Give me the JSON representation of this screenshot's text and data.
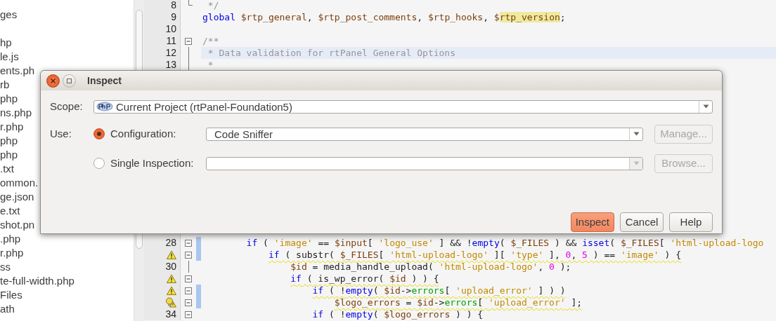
{
  "project_tree": {
    "items": [
      {
        "label": "ges"
      },
      {
        "label": "hp"
      },
      {
        "label": "le.js"
      },
      {
        "label": "ents.ph"
      },
      {
        "label": "rb"
      },
      {
        "label": "php"
      },
      {
        "label": "ns.php"
      },
      {
        "label": "r.php"
      },
      {
        "label": "php"
      },
      {
        "label": "php"
      },
      {
        "label": ".txt"
      },
      {
        "label": "ommon."
      },
      {
        "label": "ge.json"
      },
      {
        "label": "e.txt"
      },
      {
        "label": "shot.pn"
      },
      {
        "label": ".php"
      },
      {
        "label": "r.php"
      },
      {
        "label": "ss"
      },
      {
        "label": "te-full-width.php"
      },
      {
        "label": "Files"
      },
      {
        "label": "ath"
      }
    ]
  },
  "editor": {
    "top_lines": [
      {
        "number": "8",
        "fold_end": true,
        "tokens": [
          {
            "kind": "comment",
            "text": " */"
          }
        ]
      },
      {
        "number": "9",
        "tokens": [
          {
            "kind": "keyword",
            "text": "global"
          },
          {
            "kind": "variable",
            "text": " $rtp_general"
          },
          {
            "kind": "plain",
            "text": ", "
          },
          {
            "kind": "variable",
            "text": "$rtp_post_comments"
          },
          {
            "kind": "plain",
            "text": ", "
          },
          {
            "kind": "variable",
            "text": "$rtp_hooks"
          },
          {
            "kind": "plain",
            "text": ", "
          },
          {
            "kind": "variable",
            "text": "$"
          },
          {
            "kind": "variable",
            "text": "rtp_version",
            "marked": true
          },
          {
            "kind": "plain",
            "text": ";"
          }
        ]
      },
      {
        "number": "10"
      },
      {
        "number": "11",
        "fold_start": true,
        "tokens": [
          {
            "kind": "comment",
            "text": "/**"
          }
        ]
      },
      {
        "number": "12",
        "fold_line": true,
        "current": true,
        "tokens": [
          {
            "kind": "comment",
            "text": " * Data validation for rtPanel General Options"
          }
        ]
      },
      {
        "number": "13",
        "fold_line": true,
        "tokens": [
          {
            "kind": "comment",
            "text": " *"
          }
        ]
      }
    ],
    "bottom_lines": [
      {
        "number": "28",
        "fold_start": true,
        "changed": true,
        "tokens": [
          {
            "kind": "keyword",
            "text": "        if"
          },
          {
            "kind": "plain",
            "text": " ( "
          },
          {
            "kind": "string",
            "text": "'image'"
          },
          {
            "kind": "plain",
            "text": " == "
          },
          {
            "kind": "variable",
            "text": "$input"
          },
          {
            "kind": "plain",
            "text": "[ "
          },
          {
            "kind": "string",
            "text": "'logo_use'"
          },
          {
            "kind": "plain",
            "text": " ] && !"
          },
          {
            "kind": "keyword",
            "text": "empty"
          },
          {
            "kind": "plain",
            "text": "( "
          },
          {
            "kind": "variable",
            "text": "$_FILES"
          },
          {
            "kind": "plain",
            "text": " ) && "
          },
          {
            "kind": "keyword",
            "text": "isset"
          },
          {
            "kind": "plain",
            "text": "( "
          },
          {
            "kind": "variable",
            "text": "$_FILES"
          },
          {
            "kind": "plain",
            "text": "[ "
          },
          {
            "kind": "string",
            "text": "'html-upload-logo"
          }
        ]
      },
      {
        "warning": true,
        "fold_start": true,
        "changed": true,
        "warned": true,
        "tokens": [
          {
            "kind": "keyword",
            "text": "            if"
          },
          {
            "kind": "plain",
            "text": " ( substr( "
          },
          {
            "kind": "variable",
            "text": "$_FILES"
          },
          {
            "kind": "plain",
            "text": "[ "
          },
          {
            "kind": "string",
            "text": "'html-upload-logo'"
          },
          {
            "kind": "plain",
            "text": " ][ "
          },
          {
            "kind": "string",
            "text": "'type'"
          },
          {
            "kind": "plain",
            "text": " ], "
          },
          {
            "kind": "number",
            "text": "0"
          },
          {
            "kind": "plain",
            "text": ", "
          },
          {
            "kind": "number",
            "text": "5"
          },
          {
            "kind": "plain",
            "text": " ) == "
          },
          {
            "kind": "string",
            "text": "'image'"
          },
          {
            "kind": "plain",
            "text": " ) {"
          }
        ]
      },
      {
        "number": "30",
        "fold_line": true,
        "tokens": [
          {
            "kind": "variable",
            "text": "                $id"
          },
          {
            "kind": "plain",
            "text": " = media_handle_upload( "
          },
          {
            "kind": "string",
            "text": "'html-upload-logo'"
          },
          {
            "kind": "plain",
            "text": ", "
          },
          {
            "kind": "number",
            "text": "0"
          },
          {
            "kind": "plain",
            "text": " );"
          }
        ]
      },
      {
        "warning": true,
        "fold_start": true,
        "warned": true,
        "tokens": [
          {
            "kind": "keyword",
            "text": "                if"
          },
          {
            "kind": "plain",
            "text": " ( is_wp_error( "
          },
          {
            "kind": "variable",
            "text": "$id"
          },
          {
            "kind": "plain",
            "text": " ) ) {"
          }
        ]
      },
      {
        "warning": true,
        "fold_start": true,
        "changed": true,
        "warned": true,
        "tokens": [
          {
            "kind": "keyword",
            "text": "                    if"
          },
          {
            "kind": "plain",
            "text": " ( !"
          },
          {
            "kind": "keyword",
            "text": "empty"
          },
          {
            "kind": "plain",
            "text": "( "
          },
          {
            "kind": "variable",
            "text": "$id"
          },
          {
            "kind": "plain",
            "text": "->"
          },
          {
            "kind": "field",
            "text": "errors"
          },
          {
            "kind": "plain",
            "text": "[ "
          },
          {
            "kind": "string",
            "text": "'upload_error'"
          },
          {
            "kind": "plain",
            "text": " ] ) )"
          }
        ]
      },
      {
        "hint": true,
        "fold_start": true,
        "changed": true,
        "warned": true,
        "tokens": [
          {
            "kind": "variable",
            "text": "                        $logo_errors"
          },
          {
            "kind": "plain",
            "text": " = "
          },
          {
            "kind": "variable",
            "text": "$id"
          },
          {
            "kind": "plain",
            "text": "->"
          },
          {
            "kind": "field",
            "text": "errors"
          },
          {
            "kind": "plain",
            "text": "[ "
          },
          {
            "kind": "string",
            "text": "'upload_error'"
          },
          {
            "kind": "plain",
            "text": " ];"
          }
        ]
      },
      {
        "number": "34",
        "fold_start": true,
        "tokens": [
          {
            "kind": "keyword",
            "text": "                    if"
          },
          {
            "kind": "plain",
            "text": " ( !"
          },
          {
            "kind": "keyword",
            "text": "empty"
          },
          {
            "kind": "plain",
            "text": "( "
          },
          {
            "kind": "variable",
            "text": "$logo_errors"
          },
          {
            "kind": "plain",
            "text": " ) ) {"
          }
        ]
      }
    ]
  },
  "dialog": {
    "title": "Inspect",
    "scope": {
      "label": "Scope:",
      "value": "Current Project (rtPanel-Foundation5)"
    },
    "use_label": "Use:",
    "options": [
      {
        "label": "Configuration:",
        "selected": true,
        "value": "Code Sniffer",
        "combo_disabled": false,
        "button": {
          "label": "Manage...",
          "disabled": true
        }
      },
      {
        "label": "Single Inspection:",
        "selected": false,
        "combo_disabled": true,
        "button": {
          "label": "Browse...",
          "disabled": true
        }
      }
    ],
    "buttons": [
      {
        "label": "Inspect",
        "default": true
      },
      {
        "label": "Cancel",
        "default": false
      },
      {
        "label": "Help",
        "default": false
      }
    ]
  }
}
